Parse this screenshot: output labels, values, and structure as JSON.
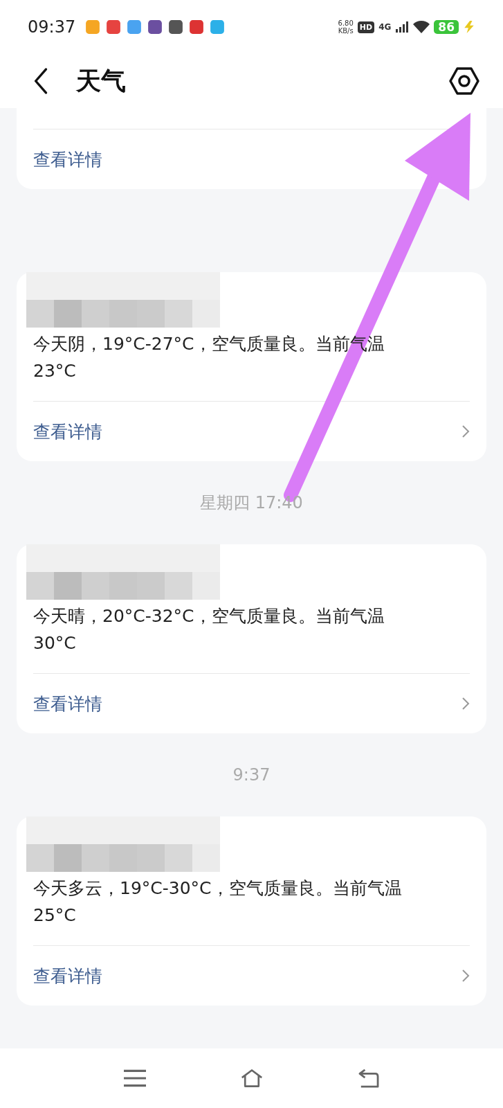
{
  "status_bar": {
    "time": "09:37",
    "net_speed_value": "6.80",
    "net_speed_unit": "KB/s",
    "hd": "HD",
    "network": "4G",
    "battery": "86",
    "charging": true
  },
  "header": {
    "title": "天气"
  },
  "top_card": {
    "link": "查看详情"
  },
  "messages": [
    {
      "text": "今天阴，19°C-27°C，空气质量良。当前气温\n23°C",
      "link": "查看详情",
      "chevron": true
    },
    {
      "timestamp": "星期四 17:40",
      "text": "今天晴，20°C-32°C，空气质量良。当前气温\n30°C",
      "link": "查看详情",
      "chevron": true
    },
    {
      "timestamp": "9:37",
      "text": "今天多云，19°C-30°C，空气质量良。当前气温\n25°C",
      "link": "查看详情",
      "chevron": true
    }
  ]
}
